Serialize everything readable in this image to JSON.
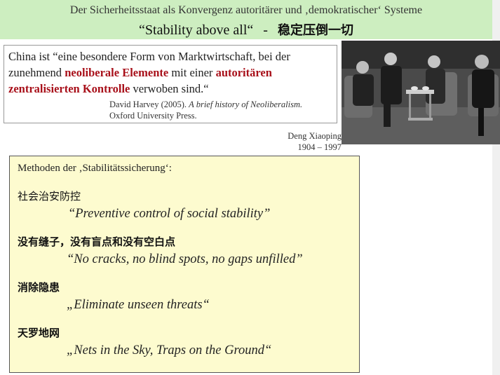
{
  "title": {
    "line1": "Der Sicherheitsstaat als Konvergenz autoritärer und ‚demokratischer‘ Systeme",
    "line2_en": "“Stability above all“",
    "line2_sep": "-",
    "line2_cn": "稳定压倒一切"
  },
  "quote": {
    "part1": "China ist “eine besondere Form von Marktwirtschaft, bei der zunehmend ",
    "em1": "neoliberale Elemente",
    "part2": " mit einer ",
    "em2": "autoritären zentralisierten Kontrolle",
    "part3": " verwoben sind.“",
    "citation_author": "David Harvey (2005). ",
    "citation_title": "A brief history of Neoliberalism.",
    "citation_publisher": "Oxford University Press."
  },
  "photo": {
    "caption_name": "Deng Xiaoping",
    "caption_years": "1904 – 1997"
  },
  "methods": {
    "heading": "Methoden der ‚Stabilitätssicherung‘:",
    "items": [
      {
        "cn": "社会治安防控",
        "en": "“Preventive control of social stability”"
      },
      {
        "cn": "没有缝子，没有盲点和没有空白点",
        "en": "“No cracks, no blind spots, no gaps unfilled”"
      },
      {
        "cn": "消除隐患",
        "en": "„Eliminate unseen threats“"
      },
      {
        "cn": "天罗地网",
        "en": "„Nets in the Sky, Traps on the Ground“"
      }
    ]
  },
  "colors": {
    "title_bg": "#cdeec0",
    "emphasis_red": "#a8101a",
    "methods_bg": "#fdfbcf"
  }
}
